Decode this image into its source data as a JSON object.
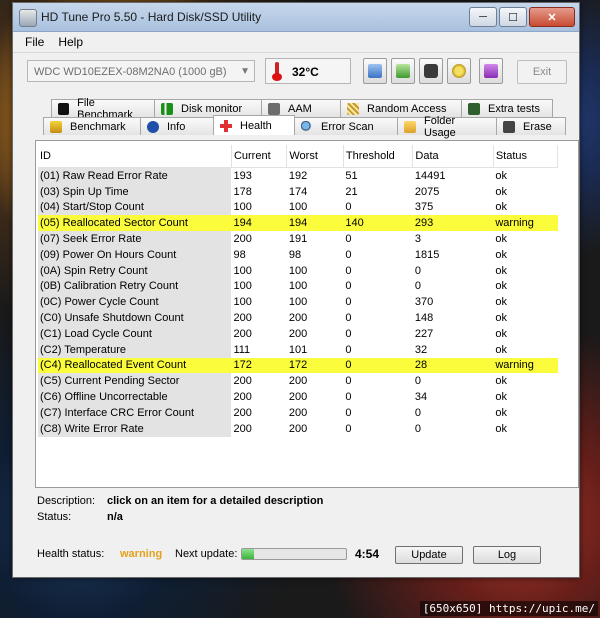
{
  "window": {
    "title": "HD Tune Pro 5.50 - Hard Disk/SSD Utility"
  },
  "menu": {
    "file": "File",
    "help": "Help"
  },
  "toolbar": {
    "drive": "WDC WD10EZEX-08M2NA0 (1000 gB)",
    "temperature": "32°C",
    "exit_label": "Exit"
  },
  "tabs": {
    "top": [
      "File Benchmark",
      "Disk monitor",
      "AAM",
      "Random Access",
      "Extra tests"
    ],
    "bottom": [
      "Benchmark",
      "Info",
      "Health",
      "Error Scan",
      "Folder Usage",
      "Erase"
    ],
    "active": "Health"
  },
  "table": {
    "headers": [
      "ID",
      "Current",
      "Worst",
      "Threshold",
      "Data",
      "Status"
    ],
    "rows": [
      [
        "(01) Raw Read Error Rate",
        "193",
        "192",
        "51",
        "14491",
        "ok"
      ],
      [
        "(03) Spin Up Time",
        "178",
        "174",
        "21",
        "2075",
        "ok"
      ],
      [
        "(04) Start/Stop Count",
        "100",
        "100",
        "0",
        "375",
        "ok"
      ],
      [
        "(05) Reallocated Sector Count",
        "194",
        "194",
        "140",
        "293",
        "warning"
      ],
      [
        "(07) Seek Error Rate",
        "200",
        "191",
        "0",
        "3",
        "ok"
      ],
      [
        "(09) Power On Hours Count",
        "98",
        "98",
        "0",
        "1815",
        "ok"
      ],
      [
        "(0A) Spin Retry Count",
        "100",
        "100",
        "0",
        "0",
        "ok"
      ],
      [
        "(0B) Calibration Retry Count",
        "100",
        "100",
        "0",
        "0",
        "ok"
      ],
      [
        "(0C) Power Cycle Count",
        "100",
        "100",
        "0",
        "370",
        "ok"
      ],
      [
        "(C0) Unsafe Shutdown Count",
        "200",
        "200",
        "0",
        "148",
        "ok"
      ],
      [
        "(C1) Load Cycle Count",
        "200",
        "200",
        "0",
        "227",
        "ok"
      ],
      [
        "(C2) Temperature",
        "111",
        "101",
        "0",
        "32",
        "ok"
      ],
      [
        "(C4) Reallocated Event Count",
        "172",
        "172",
        "0",
        "28",
        "warning"
      ],
      [
        "(C5) Current Pending Sector",
        "200",
        "200",
        "0",
        "0",
        "ok"
      ],
      [
        "(C6) Offline Uncorrectable",
        "200",
        "200",
        "0",
        "34",
        "ok"
      ],
      [
        "(C7) Interface CRC Error Count",
        "200",
        "200",
        "0",
        "0",
        "ok"
      ],
      [
        "(C8) Write Error Rate",
        "200",
        "200",
        "0",
        "0",
        "ok"
      ]
    ]
  },
  "details": {
    "description_label": "Description:",
    "description_value": "click on an item for a detailed description",
    "status_label": "Status:",
    "status_value": "n/a"
  },
  "health": {
    "label": "Health status:",
    "value": "warning",
    "next_update_label": "Next update:",
    "next_update_time": "4:54",
    "progress": 0.12,
    "update_button": "Update",
    "log_button": "Log"
  },
  "watermark": "[650x650] https://upic.me/"
}
